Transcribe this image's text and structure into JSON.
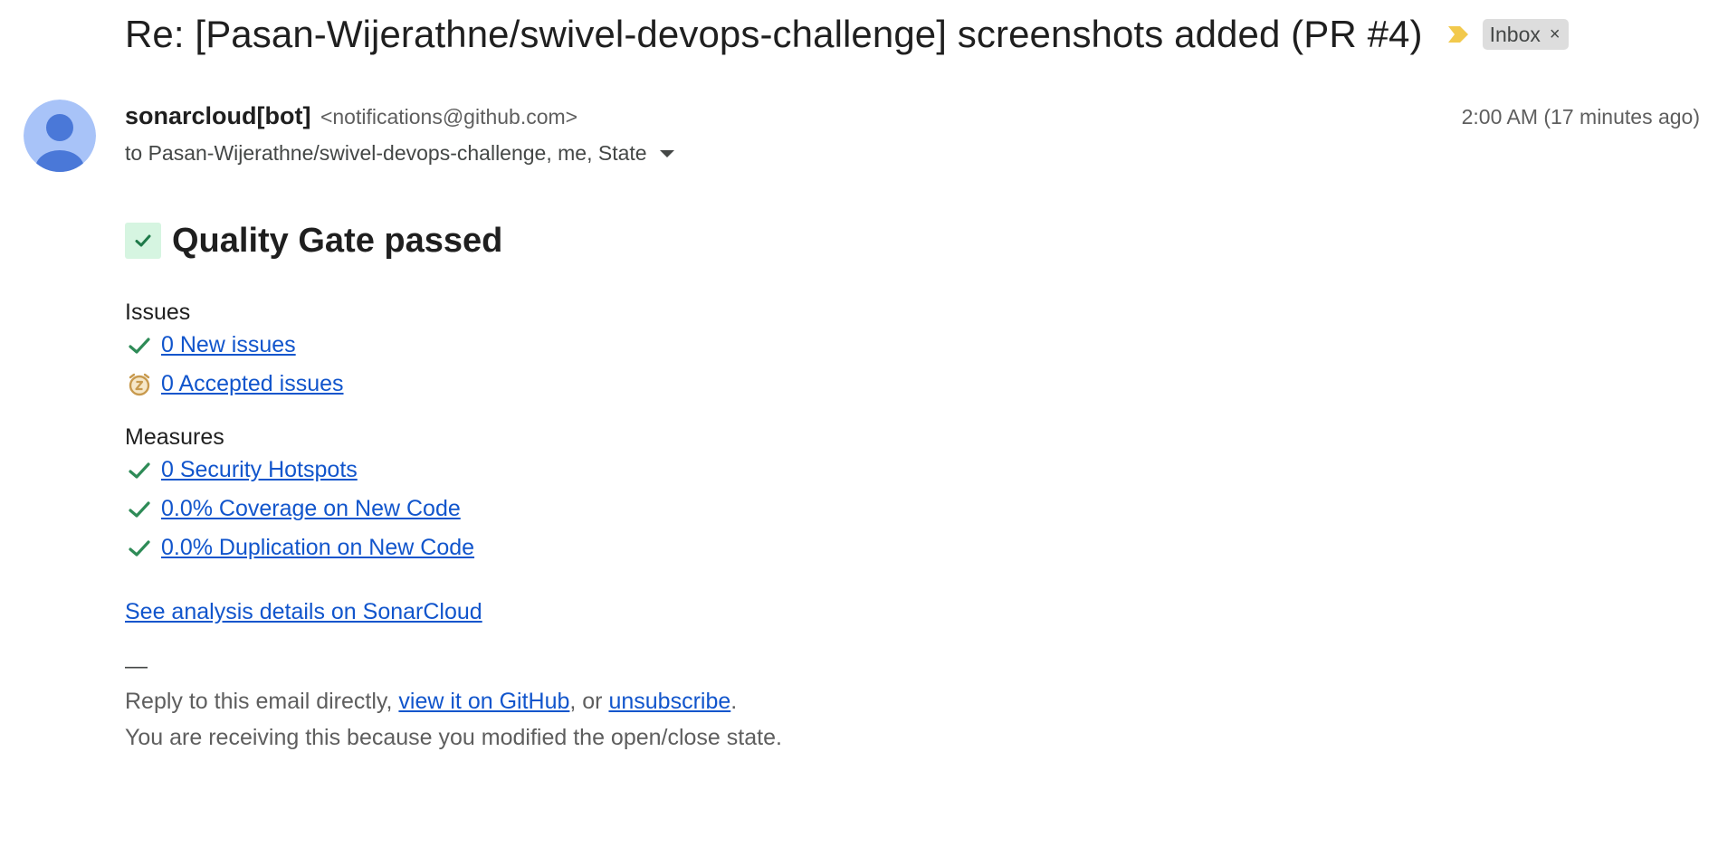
{
  "email": {
    "subject": "Re: [Pasan-Wijerathne/swivel-devops-challenge] screenshots added (PR #4)",
    "label": "Inbox",
    "label_remove": "×",
    "sender_name": "sonarcloud[bot]",
    "sender_email": "<notifications@github.com>",
    "time": "2:00 AM (17 minutes ago)",
    "recipients": "to Pasan-Wijerathne/swivel-devops-challenge, me, State"
  },
  "body": {
    "quality_gate": "Quality Gate passed",
    "issues_title": "Issues",
    "issues": [
      {
        "icon": "check-icon",
        "text": "0 New issues"
      },
      {
        "icon": "alarm-clock-icon",
        "text": "0 Accepted issues"
      }
    ],
    "measures_title": "Measures",
    "measures": [
      {
        "icon": "check-icon",
        "text": "0 Security Hotspots"
      },
      {
        "icon": "check-icon",
        "text": "0.0% Coverage on New Code"
      },
      {
        "icon": "check-icon",
        "text": "0.0% Duplication on New Code"
      }
    ],
    "analysis_link": "See analysis details on SonarCloud"
  },
  "footer": {
    "dash": "—",
    "reply_prefix": "Reply to this email directly, ",
    "view_link": "view it on GitHub",
    "or_text": ", or ",
    "unsubscribe_link": "unsubscribe",
    "period": ".",
    "reason": "You are receiving this because you modified the open/close state."
  },
  "colors": {
    "link": "#1155cc",
    "check": "#2e8b57",
    "importance_marker": "#f2c94c",
    "avatar_bg": "#a8c3f8",
    "avatar_fg": "#4a78d8"
  }
}
